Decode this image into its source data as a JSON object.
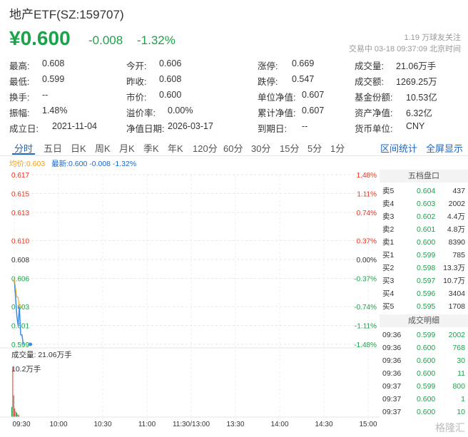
{
  "header": {
    "title": "地产ETF(SZ:159707)",
    "price": "¥0.600",
    "change": "-0.008",
    "change_pct": "-1.32%",
    "follow": "1.19 万球友关注",
    "status": "交易中 03-18 09:37:09 北京时间"
  },
  "quote": [
    [
      {
        "label": "最高:",
        "value": "0.608",
        "color": "default"
      },
      {
        "label": "今开:",
        "value": "0.606",
        "color": "green"
      },
      {
        "label": "涨停:",
        "value": "0.669",
        "color": "red"
      },
      {
        "label": "成交量:",
        "value": "21.06万手",
        "color": "default"
      }
    ],
    [
      {
        "label": "最低:",
        "value": "0.599",
        "color": "green"
      },
      {
        "label": "昨收:",
        "value": "0.608",
        "color": "default"
      },
      {
        "label": "跌停:",
        "value": "0.547",
        "color": "green"
      },
      {
        "label": "成交额:",
        "value": "1269.25万",
        "color": "default"
      }
    ],
    [
      {
        "label": "换手:",
        "value": "--",
        "color": "default"
      },
      {
        "label": "市价:",
        "value": "0.600",
        "color": "default"
      },
      {
        "label": "单位净值:",
        "value": "0.607",
        "color": "default"
      },
      {
        "label": "基金份额:",
        "value": "10.53亿",
        "color": "default"
      }
    ],
    [
      {
        "label": "振幅:",
        "value": "1.48%",
        "color": "default"
      },
      {
        "label": "溢价率:",
        "value": "0.00%",
        "color": "default"
      },
      {
        "label": "累计净值:",
        "value": "0.607",
        "color": "default"
      },
      {
        "label": "资产净值:",
        "value": "6.32亿",
        "color": "default"
      }
    ],
    [
      {
        "label": "成立日:",
        "value": "2021-11-04",
        "color": "default"
      },
      {
        "label": "净值日期:",
        "value": "2026-03-17",
        "color": "default"
      },
      {
        "label": "到期日:",
        "value": "--",
        "color": "default"
      },
      {
        "label": "货币单位:",
        "value": "CNY",
        "color": "default"
      }
    ]
  ],
  "tabs": [
    "分时",
    "五日",
    "日K",
    "周K",
    "月K",
    "季K",
    "年K",
    "120分",
    "60分",
    "30分",
    "15分",
    "5分",
    "1分"
  ],
  "active_tab": "分时",
  "right_links": [
    "区间统计",
    "全屏显示"
  ],
  "legend": {
    "avg": "均价:0.603",
    "latest": "最新:0.600 -0.008 -1.32%"
  },
  "colors": {
    "up": "#e8331b",
    "down": "#1aa34a",
    "accent": "#1a66c4",
    "avg_line": "#f0a020",
    "price_line": "#3a8ee6"
  },
  "chart_data": {
    "type": "line",
    "price_axis": [
      "0.617",
      "0.615",
      "0.613",
      "0.610",
      "0.608",
      "0.606",
      "0.603",
      "0.601",
      "0.599"
    ],
    "price_values": [
      0.617,
      0.615,
      0.613,
      0.61,
      0.608,
      0.606,
      0.603,
      0.601,
      0.599
    ],
    "pct_axis": [
      "1.48%",
      "1.11%",
      "0.74%",
      "0.37%",
      "0.00%",
      "-0.37%",
      "-0.74%",
      "-1.11%",
      "-1.48%"
    ],
    "x_ticks": [
      "09:30",
      "10:00",
      "10:30",
      "11:00",
      "11:30/13:00",
      "13:30",
      "14:00",
      "14:30",
      "15:00"
    ],
    "price_line": [
      0.606,
      0.604,
      0.602,
      0.601,
      0.603,
      0.6,
      0.6,
      0.599
    ],
    "avg_line": [
      0.606,
      0.605,
      0.604,
      0.604,
      0.603,
      0.603,
      0.603,
      0.603
    ],
    "volume_label": "成交量: 21.06万手",
    "volume_max_label": "10.2万手",
    "volume_max": 10.2,
    "volume_values": [
      2.1,
      10.2,
      4.5,
      1.8,
      1.2,
      0.9,
      0.6,
      0.4
    ]
  },
  "order_book": {
    "title": "五档盘口",
    "asks": [
      {
        "label": "卖5",
        "price": "0.604",
        "vol": "437"
      },
      {
        "label": "卖4",
        "price": "0.603",
        "vol": "2002"
      },
      {
        "label": "卖3",
        "price": "0.602",
        "vol": "4.4万"
      },
      {
        "label": "卖2",
        "price": "0.601",
        "vol": "4.8万"
      },
      {
        "label": "卖1",
        "price": "0.600",
        "vol": "8390"
      }
    ],
    "bids": [
      {
        "label": "买1",
        "price": "0.599",
        "vol": "785"
      },
      {
        "label": "买2",
        "price": "0.598",
        "vol": "13.3万"
      },
      {
        "label": "买3",
        "price": "0.597",
        "vol": "10.7万"
      },
      {
        "label": "买4",
        "price": "0.596",
        "vol": "3404"
      },
      {
        "label": "买5",
        "price": "0.595",
        "vol": "1708"
      }
    ]
  },
  "trades": {
    "title": "成交明细",
    "rows": [
      {
        "time": "09:36",
        "price": "0.599",
        "vol": "2002"
      },
      {
        "time": "09:36",
        "price": "0.600",
        "vol": "768"
      },
      {
        "time": "09:36",
        "price": "0.600",
        "vol": "30"
      },
      {
        "time": "09:36",
        "price": "0.600",
        "vol": "11"
      },
      {
        "time": "09:37",
        "price": "0.599",
        "vol": "800"
      },
      {
        "time": "09:37",
        "price": "0.600",
        "vol": "1"
      },
      {
        "time": "09:37",
        "price": "0.600",
        "vol": "10"
      }
    ]
  },
  "watermark": "格隆汇"
}
